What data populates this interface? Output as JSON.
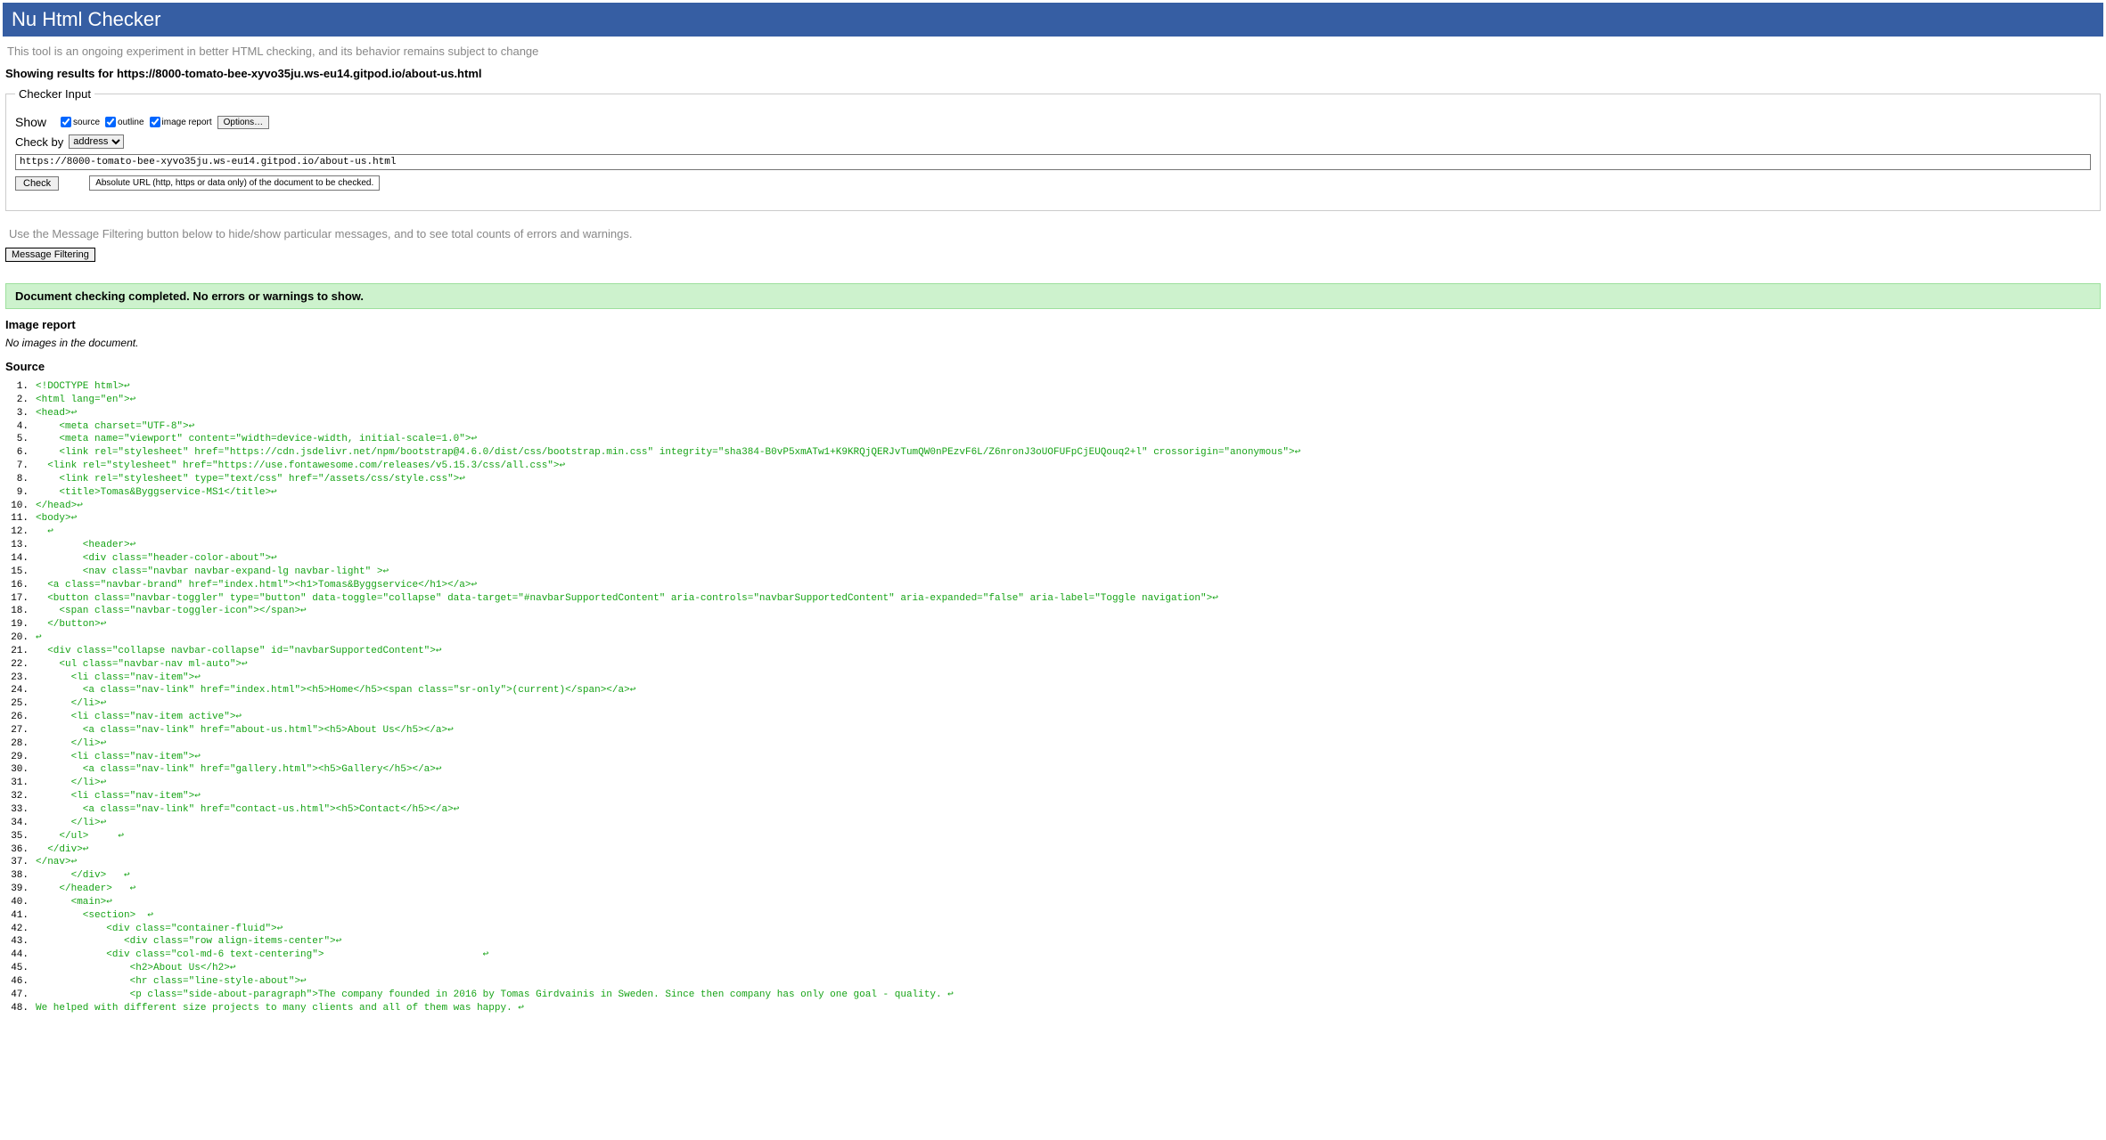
{
  "header": {
    "title": "Nu Html Checker"
  },
  "intro": "This tool is an ongoing experiment in better HTML checking, and its behavior remains subject to change",
  "resultsHeading": "Showing results for https://8000-tomato-bee-xyvo35ju.ws-eu14.gitpod.io/about-us.html",
  "checker": {
    "legend": "Checker Input",
    "showLabel": "Show",
    "cbSource": "source",
    "cbOutline": "outline",
    "cbImageReport": "image report",
    "optionsBtn": "Options…",
    "checkByLabel": "Check by",
    "checkBySelected": "address",
    "urlValue": "https://8000-tomato-bee-xyvo35ju.ws-eu14.gitpod.io/about-us.html",
    "checkBtn": "Check",
    "tooltip": "Absolute URL (http, https or data only) of the document to be checked."
  },
  "filterHint": "Use the Message Filtering button below to hide/show particular messages, and to see total counts of errors and warnings.",
  "msgFilterBtn": "Message Filtering",
  "successMsg": "Document checking completed. No errors or warnings to show.",
  "imageReport": {
    "heading": "Image report",
    "none": "No images in the document."
  },
  "sourceHeading": "Source",
  "sourceLines": [
    "<!DOCTYPE html>↩",
    "<html lang=\"en\">↩",
    "<head>↩",
    "    <meta charset=\"UTF-8\">↩",
    "    <meta name=\"viewport\" content=\"width=device-width, initial-scale=1.0\">↩",
    "    <link rel=\"stylesheet\" href=\"https://cdn.jsdelivr.net/npm/bootstrap@4.6.0/dist/css/bootstrap.min.css\" integrity=\"sha384-B0vP5xmATw1+K9KRQjQERJvTumQW0nPEzvF6L/Z6nronJ3oUOFUFpCjEUQouq2+l\" crossorigin=\"anonymous\">↩",
    "  <link rel=\"stylesheet\" href=\"https://use.fontawesome.com/releases/v5.15.3/css/all.css\">↩",
    "    <link rel=\"stylesheet\" type=\"text/css\" href=\"/assets/css/style.css\">↩",
    "    <title>Tomas&Byggservice-MS1</title>↩",
    "</head>↩",
    "<body>↩",
    "  ↩",
    "        <header>↩",
    "        <div class=\"header-color-about\">↩",
    "        <nav class=\"navbar navbar-expand-lg navbar-light\" >↩",
    "  <a class=\"navbar-brand\" href=\"index.html\"><h1>Tomas&Byggservice</h1></a>↩",
    "  <button class=\"navbar-toggler\" type=\"button\" data-toggle=\"collapse\" data-target=\"#navbarSupportedContent\" aria-controls=\"navbarSupportedContent\" aria-expanded=\"false\" aria-label=\"Toggle navigation\">↩",
    "    <span class=\"navbar-toggler-icon\"></span>↩",
    "  </button>↩",
    "↩",
    "  <div class=\"collapse navbar-collapse\" id=\"navbarSupportedContent\">↩",
    "    <ul class=\"navbar-nav ml-auto\">↩",
    "      <li class=\"nav-item\">↩",
    "        <a class=\"nav-link\" href=\"index.html\"><h5>Home</h5><span class=\"sr-only\">(current)</span></a>↩",
    "      </li>↩",
    "      <li class=\"nav-item active\">↩",
    "        <a class=\"nav-link\" href=\"about-us.html\"><h5>About Us</h5></a>↩",
    "      </li>↩",
    "      <li class=\"nav-item\">↩",
    "        <a class=\"nav-link\" href=\"gallery.html\"><h5>Gallery</h5></a>↩",
    "      </li>↩",
    "      <li class=\"nav-item\">↩",
    "        <a class=\"nav-link\" href=\"contact-us.html\"><h5>Contact</h5></a>↩",
    "      </li>↩",
    "    </ul>     ↩",
    "  </div>↩",
    "</nav>↩",
    "      </div>   ↩",
    "    </header>   ↩",
    "      <main>↩",
    "        <section>  ↩",
    "            <div class=\"container-fluid\">↩",
    "               <div class=\"row align-items-center\">↩",
    "            <div class=\"col-md-6 text-centering\">                           ↩",
    "                <h2>About Us</h2>↩",
    "                <hr class=\"line-style-about\">↩",
    "                <p class=\"side-about-paragraph\">The company founded in 2016 by Tomas Girdvainis in Sweden. Since then company has only one goal - quality. ↩",
    "We helped with different size projects to many clients and all of them was happy. ↩"
  ]
}
